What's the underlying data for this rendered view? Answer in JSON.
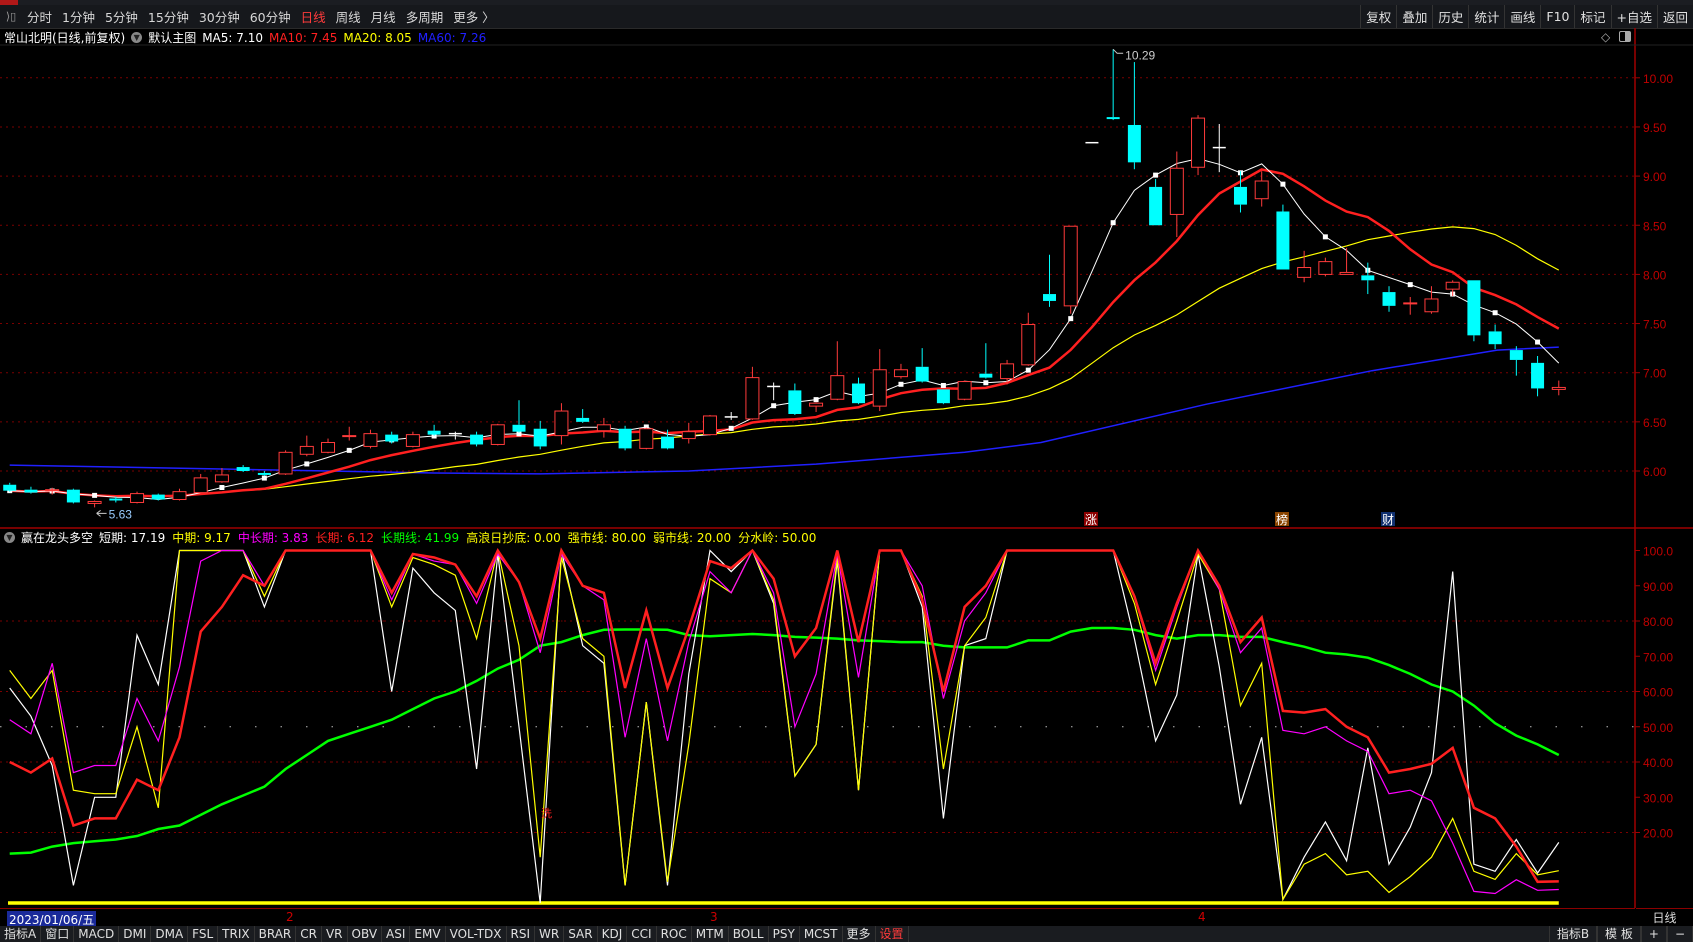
{
  "toolbar": {
    "periods": [
      "分时",
      "1分钟",
      "5分钟",
      "15分钟",
      "30分钟",
      "60分钟",
      "日线",
      "周线",
      "月线",
      "多周期",
      "更多 〉"
    ],
    "active_period": "日线",
    "right_buttons": [
      "复权",
      "叠加",
      "历史",
      "统计",
      "画线",
      "F10",
      "标记",
      "+自选",
      "返回"
    ]
  },
  "main": {
    "title": "常山北明(日线,前复权)",
    "template": "默认主图",
    "ma": [
      {
        "label": "MA5: 7.10",
        "color": "#ffffff"
      },
      {
        "label": "MA10: 7.45",
        "color": "#ff2020"
      },
      {
        "label": "MA20: 8.05",
        "color": "#ffff00"
      },
      {
        "label": "MA60: 7.26",
        "color": "#2020ff"
      }
    ],
    "high_label": "10.29",
    "low_label": "5.63",
    "markers": [
      {
        "text": "涨",
        "color": "#8b0000"
      },
      {
        "text": "榜",
        "color": "#8b4500"
      },
      {
        "text": "财",
        "color": "#103070"
      }
    ],
    "price_ticks": [
      "10.00",
      "9.50",
      "9.00",
      "8.50",
      "8.00",
      "7.50",
      "7.00",
      "6.50",
      "6.00"
    ]
  },
  "indicator": {
    "name": "赢在龙头多空",
    "values": [
      {
        "label": "短期: 17.19",
        "color": "#ffffff"
      },
      {
        "label": "中期: 9.17",
        "color": "#ffff00"
      },
      {
        "label": "中长期: 3.83",
        "color": "#ff00ff"
      },
      {
        "label": "长期: 6.12",
        "color": "#ff2020"
      },
      {
        "label": "长期线: 41.99",
        "color": "#00ff00"
      },
      {
        "label": "高浪日抄底: 0.00",
        "color": "#ffff00"
      },
      {
        "label": "强市线: 80.00",
        "color": "#ffff00"
      },
      {
        "label": "弱市线: 20.00",
        "color": "#ffff00"
      },
      {
        "label": "分水岭: 50.00",
        "color": "#ffff00"
      }
    ],
    "signal_text": "洗",
    "ticks": [
      "100.0",
      "90.00",
      "80.00",
      "70.00",
      "60.00",
      "50.00",
      "40.00",
      "30.00",
      "20.00"
    ]
  },
  "date_axis": {
    "current": "2023/01/06/五",
    "months": [
      "2",
      "3",
      "4"
    ],
    "period_label": "日线"
  },
  "bottom_tabs": [
    "指标A",
    "窗口",
    "MACD",
    "DMI",
    "DMA",
    "FSL",
    "TRIX",
    "BRAR",
    "CR",
    "VR",
    "OBV",
    "ASI",
    "EMV",
    "VOL-TDX",
    "RSI",
    "WR",
    "SAR",
    "KDJ",
    "CCI",
    "ROC",
    "MTM",
    "BOLL",
    "PSY",
    "MCST",
    "更多",
    "设置"
  ],
  "bottom_right_tabs": [
    "指标B",
    "模 板",
    "+",
    "−"
  ],
  "colors": {
    "up": "#ff3b3b",
    "down": "#00ffff",
    "grid": "#8b0000"
  },
  "chart_data": {
    "type": "candlestick",
    "ylim": [
      5.5,
      10.5
    ],
    "candles_ohlc": [
      [
        5.86,
        5.88,
        5.79,
        5.8
      ],
      [
        5.81,
        5.84,
        5.77,
        5.78
      ],
      [
        5.8,
        5.83,
        5.76,
        5.81
      ],
      [
        5.81,
        5.82,
        5.67,
        5.68
      ],
      [
        5.67,
        5.7,
        5.63,
        5.69
      ],
      [
        5.72,
        5.74,
        5.68,
        5.7
      ],
      [
        5.68,
        5.79,
        5.67,
        5.77
      ],
      [
        5.76,
        5.77,
        5.7,
        5.71
      ],
      [
        5.71,
        5.82,
        5.7,
        5.79
      ],
      [
        5.78,
        5.97,
        5.77,
        5.93
      ],
      [
        5.89,
        6.03,
        5.88,
        5.96
      ],
      [
        6.04,
        6.06,
        5.99,
        6.0
      ],
      [
        5.98,
        6.0,
        5.95,
        5.96
      ],
      [
        5.97,
        6.21,
        5.96,
        6.19
      ],
      [
        6.17,
        6.36,
        6.15,
        6.25
      ],
      [
        6.19,
        6.33,
        6.18,
        6.29
      ],
      [
        6.35,
        6.45,
        6.31,
        6.36
      ],
      [
        6.25,
        6.42,
        6.23,
        6.38
      ],
      [
        6.37,
        6.4,
        6.28,
        6.3
      ],
      [
        6.25,
        6.4,
        6.24,
        6.37
      ],
      [
        6.41,
        6.47,
        6.36,
        6.37
      ],
      [
        6.38,
        6.4,
        6.32,
        6.38
      ],
      [
        6.37,
        6.4,
        6.25,
        6.27
      ],
      [
        6.27,
        6.48,
        6.26,
        6.47
      ],
      [
        6.47,
        6.72,
        6.39,
        6.4
      ],
      [
        6.43,
        6.51,
        6.22,
        6.25
      ],
      [
        6.36,
        6.69,
        6.27,
        6.61
      ],
      [
        6.54,
        6.63,
        6.49,
        6.5
      ],
      [
        6.41,
        6.54,
        6.34,
        6.47
      ],
      [
        6.43,
        6.46,
        6.21,
        6.23
      ],
      [
        6.23,
        6.44,
        6.22,
        6.43
      ],
      [
        6.35,
        6.42,
        6.22,
        6.23
      ],
      [
        6.33,
        6.49,
        6.28,
        6.4
      ],
      [
        6.37,
        6.57,
        6.36,
        6.56
      ],
      [
        6.55,
        6.6,
        6.52,
        6.55
      ],
      [
        6.53,
        7.06,
        6.52,
        6.95
      ],
      [
        6.86,
        6.9,
        6.72,
        6.86
      ],
      [
        6.82,
        6.89,
        6.57,
        6.58
      ],
      [
        6.66,
        6.7,
        6.6,
        6.69
      ],
      [
        6.73,
        7.32,
        6.72,
        6.97
      ],
      [
        6.89,
        6.95,
        6.68,
        6.69
      ],
      [
        6.66,
        7.24,
        6.61,
        7.03
      ],
      [
        6.96,
        7.09,
        6.94,
        7.03
      ],
      [
        7.06,
        7.25,
        6.9,
        6.91
      ],
      [
        6.83,
        6.83,
        6.68,
        6.69
      ],
      [
        6.73,
        6.92,
        6.72,
        6.91
      ],
      [
        6.99,
        7.3,
        6.94,
        6.95
      ],
      [
        6.94,
        7.13,
        6.88,
        7.09
      ],
      [
        7.08,
        7.61,
        7.07,
        7.49
      ],
      [
        7.8,
        8.2,
        7.67,
        7.73
      ],
      [
        7.68,
        8.49,
        7.6,
        8.49
      ],
      [
        9.34,
        9.34,
        9.34,
        9.34
      ],
      [
        9.6,
        10.29,
        9.57,
        9.58
      ],
      [
        9.52,
        10.16,
        9.07,
        9.14
      ],
      [
        8.89,
        8.97,
        8.5,
        8.5
      ],
      [
        8.61,
        9.25,
        8.38,
        9.08
      ],
      [
        9.09,
        9.62,
        9.01,
        9.59
      ],
      [
        9.29,
        9.53,
        9.04,
        9.29
      ],
      [
        8.89,
        9.05,
        8.63,
        8.71
      ],
      [
        8.77,
        9.05,
        8.69,
        8.95
      ],
      [
        8.64,
        8.71,
        8.05,
        8.05
      ],
      [
        7.97,
        8.24,
        7.92,
        8.07
      ],
      [
        8.0,
        8.17,
        7.98,
        8.13
      ],
      [
        8.0,
        8.27,
        8.0,
        8.02
      ],
      [
        7.99,
        8.12,
        7.8,
        7.94
      ],
      [
        7.82,
        7.88,
        7.62,
        7.68
      ],
      [
        7.7,
        7.77,
        7.59,
        7.71
      ],
      [
        7.62,
        7.88,
        7.6,
        7.75
      ],
      [
        7.85,
        7.94,
        7.78,
        7.92
      ],
      [
        7.94,
        7.94,
        7.32,
        7.38
      ],
      [
        7.42,
        7.49,
        7.24,
        7.29
      ],
      [
        7.23,
        7.27,
        6.97,
        7.13
      ],
      [
        7.1,
        7.17,
        6.76,
        6.84
      ],
      [
        6.83,
        6.92,
        6.77,
        6.85
      ]
    ],
    "ma60_points": [
      [
        0,
        6.06
      ],
      [
        10,
        6.02
      ],
      [
        20,
        5.98
      ],
      [
        25,
        5.97
      ],
      [
        32,
        6.0
      ],
      [
        38,
        6.07
      ],
      [
        45,
        6.19
      ],
      [
        48.6,
        6.29
      ],
      [
        56.4,
        6.68
      ],
      [
        64.2,
        7.02
      ],
      [
        70.1,
        7.23
      ],
      [
        73,
        7.26
      ]
    ],
    "indicator_ylim": [
      0,
      100
    ],
    "indicator_series": [
      {
        "name": "短期",
        "color": "#ffffff",
        "values": [
          61,
          53,
          39,
          5,
          30,
          30,
          76,
          62,
          100,
          100,
          100,
          100,
          84,
          100,
          100,
          100,
          100,
          100,
          60,
          95,
          88,
          83,
          38,
          99,
          50,
          0,
          100,
          73,
          68,
          5,
          57,
          5,
          65,
          100,
          94,
          100,
          85,
          36,
          45,
          97,
          32,
          100,
          100,
          84,
          24,
          73,
          75,
          100,
          100,
          100,
          100,
          100,
          100,
          75,
          46,
          59,
          99,
          67,
          28,
          47,
          1,
          13,
          23,
          12,
          44,
          11,
          21.5,
          37,
          94,
          11,
          9,
          18,
          8.5,
          17.19
        ]
      },
      {
        "name": "中期",
        "color": "#ffff00",
        "values": [
          66,
          58,
          66,
          32,
          31,
          31,
          50,
          27,
          100,
          100,
          100,
          100,
          87,
          100,
          100,
          100,
          100,
          100,
          84,
          98,
          96,
          93,
          75,
          100,
          73,
          13,
          98,
          75,
          70,
          5,
          57,
          6,
          45,
          92,
          88,
          100,
          86,
          36,
          45,
          98,
          32,
          100,
          100,
          87,
          38,
          73,
          81,
          100,
          100,
          100,
          100,
          100,
          100,
          85,
          62,
          80,
          99,
          89,
          56,
          68,
          1,
          11,
          14,
          8,
          9,
          3,
          7.5,
          13,
          24,
          9,
          6.7,
          14,
          8,
          9.17
        ]
      },
      {
        "name": "中长期",
        "color": "#ff00ff",
        "values": [
          52,
          48,
          68,
          37,
          39,
          39,
          58,
          46,
          67,
          97,
          100,
          100,
          90,
          100,
          100,
          100,
          100,
          100,
          86,
          99,
          97,
          96,
          85,
          99,
          91,
          71,
          99,
          90,
          86,
          47,
          75,
          46,
          74,
          94,
          88,
          100,
          88,
          50,
          65,
          99,
          64,
          100,
          100,
          90,
          58,
          80,
          88,
          100,
          100,
          100,
          100,
          100,
          100,
          87,
          66,
          84,
          100,
          89,
          71,
          78,
          49,
          48,
          50,
          46,
          43,
          31,
          32,
          29,
          17,
          3.3,
          2.7,
          6.6,
          3.6,
          3.83
        ]
      },
      {
        "name": "长期",
        "color": "#ff2020",
        "values": [
          40,
          37,
          41,
          22,
          24,
          24,
          35,
          32,
          47,
          77,
          84,
          93,
          90,
          100,
          100,
          100,
          100,
          100,
          88,
          99,
          98,
          96,
          87,
          100,
          91,
          75,
          100,
          90,
          88,
          61,
          83,
          61,
          78,
          97,
          95,
          100,
          92,
          70,
          78,
          100,
          74,
          100,
          100,
          86,
          60,
          84,
          90,
          100,
          100,
          100,
          100,
          100,
          100,
          87,
          68,
          85,
          100,
          90,
          74,
          81,
          54.5,
          54,
          55,
          50,
          47,
          37,
          38,
          39.5,
          44,
          27,
          24,
          16,
          6,
          6.12
        ]
      },
      {
        "name": "长期线",
        "color": "#00ff00",
        "values": [
          14,
          14.3,
          16,
          17,
          17.5,
          18,
          19,
          21,
          22,
          25,
          28,
          30.5,
          33,
          38,
          42,
          46,
          48,
          50,
          52,
          55,
          58,
          60,
          63,
          66.5,
          69,
          73,
          74,
          76,
          77.5,
          77.6,
          77.6,
          77.5,
          76,
          75.7,
          76,
          76.3,
          76,
          75.5,
          75.3,
          75,
          74.5,
          74.3,
          74,
          74,
          73,
          72.5,
          72.5,
          72.5,
          74.5,
          74.5,
          77,
          78,
          78,
          77.5,
          76,
          75,
          76,
          76,
          75.5,
          75.5,
          74,
          72.7,
          71,
          70.5,
          69.6,
          67.5,
          65,
          62,
          60,
          56,
          51,
          47.5,
          45,
          41.99
        ]
      }
    ],
    "indicator_baseline": 0
  }
}
